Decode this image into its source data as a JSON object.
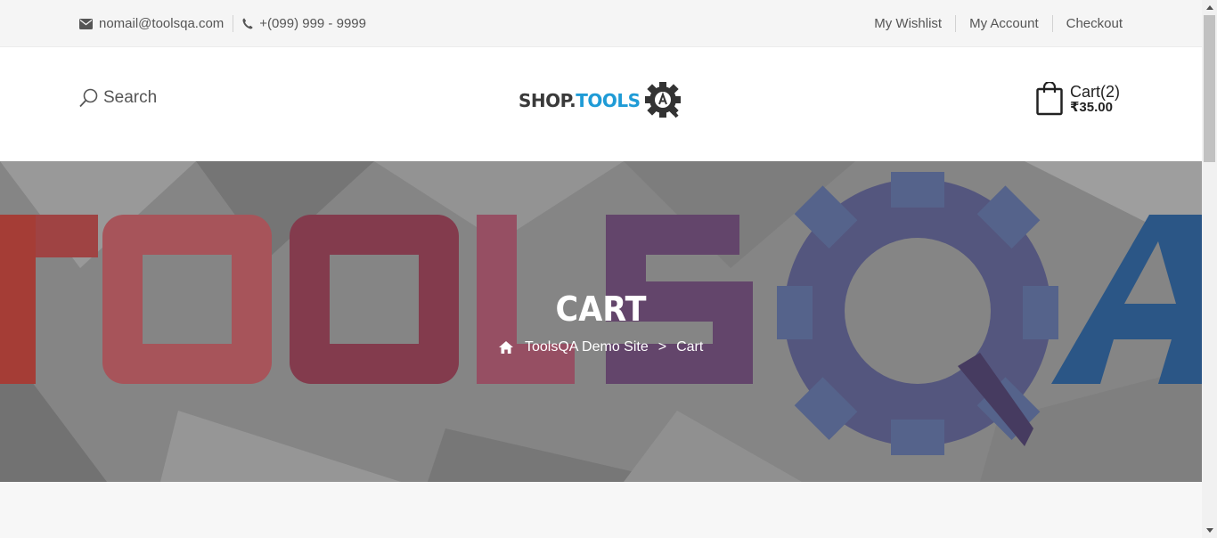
{
  "topbar": {
    "email": "nomail@toolsqa.com",
    "phone": "+(099) 999 - 9999",
    "links": {
      "wishlist": "My Wishlist",
      "account": "My Account",
      "checkout": "Checkout"
    }
  },
  "header": {
    "search_label": "Search",
    "logo": {
      "part1": "SHOP.",
      "part2": "TOOLS"
    },
    "cart": {
      "label": "Cart(2)",
      "amount": "₹35.00"
    }
  },
  "banner": {
    "title": "CART",
    "breadcrumb": {
      "home": "ToolsQA Demo Site",
      "separator": ">",
      "current": "Cart"
    }
  },
  "colors": {
    "accent": "#1f9bd6",
    "topbar_bg": "#f5f5f5",
    "banner_gray": "#8f8f8f"
  },
  "icons": [
    "envelope-icon",
    "phone-icon",
    "search-icon",
    "shopping-bag-icon",
    "home-icon"
  ]
}
